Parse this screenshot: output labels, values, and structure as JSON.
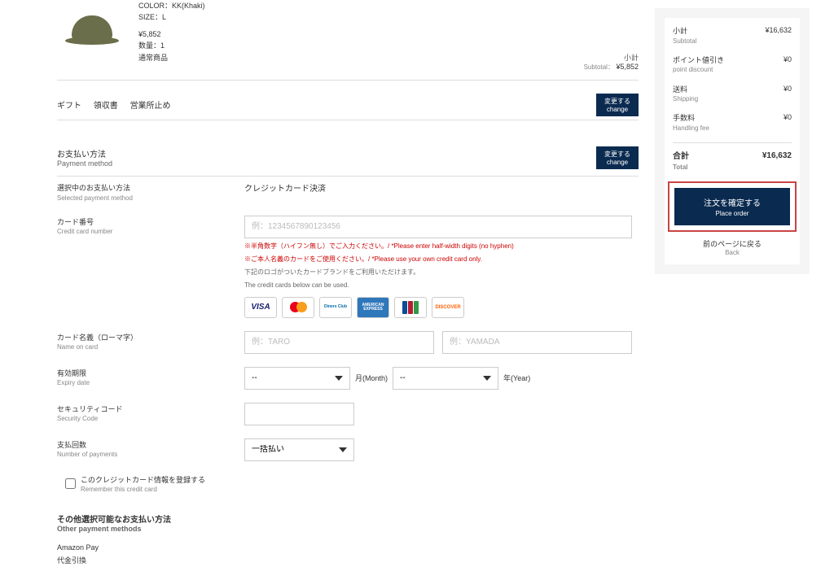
{
  "product": {
    "color_label": "COLOR：KK(Khaki)",
    "size_label": "SIZE：L",
    "price": "¥5,852",
    "qty": "数量：1",
    "type": "通常商品",
    "subtotal_jp": "小計",
    "subtotal_en": "Subtotal：",
    "subtotal_val": "¥5,852"
  },
  "gift": {
    "item1": "ギフト",
    "item2": "領収書",
    "item3": "営業所止め",
    "change_jp": "変更する",
    "change_en": "change"
  },
  "payment_section": {
    "title_jp": "お支払い方法",
    "title_en": "Payment method",
    "change_jp": "変更する",
    "change_en": "change"
  },
  "selected": {
    "label_jp": "選択中のお支払い方法",
    "label_en": "Selected payment method",
    "value": "クレジットカード決済"
  },
  "card_number": {
    "label_jp": "カード番号",
    "label_en": "Credit card number",
    "placeholder": "例：1234567890123456",
    "note1": "※半角数字（ハイフン無し）でご入力ください。/ *Please enter half-width digits (no hyphen)",
    "note2": "※ご本人名義のカードをご使用ください。/ *Please use your own credit card only.",
    "note3_jp": "下記のロゴがついたカードブランドをご利用いただけます。",
    "note3_en": "The credit cards below can be used."
  },
  "card_name": {
    "label_jp": "カード名義（ローマ字）",
    "label_en": "Name on card",
    "placeholder_first": "例：TARO",
    "placeholder_last": "例：YAMADA"
  },
  "expiry": {
    "label_jp": "有効期限",
    "label_en": "Expiry date",
    "month_opt": "--",
    "month_label": "月(Month)",
    "year_opt": "--",
    "year_label": "年(Year)"
  },
  "security": {
    "label_jp": "セキュリティコード",
    "label_en": "Security Code"
  },
  "pay_count": {
    "label_jp": "支払回数",
    "label_en": "Number of payments",
    "opt": "一括払い"
  },
  "remember": {
    "label_jp": "このクレジットカード情報を登録する",
    "label_en": "Remember this credit card"
  },
  "other": {
    "title_jp": "その他選択可能なお支払い方法",
    "title_en": "Other payment methods",
    "item1": "Amazon Pay",
    "item2": "代金引換"
  },
  "summary": {
    "subtotal_jp": "小計",
    "subtotal_en": "Subtotal",
    "subtotal_val": "¥16,632",
    "point_jp": "ポイント値引き",
    "point_en": "point discount",
    "point_val": "¥0",
    "shipping_jp": "送料",
    "shipping_en": "Shipping",
    "shipping_val": "¥0",
    "fee_jp": "手数料",
    "fee_en": "Handling fee",
    "fee_val": "¥0",
    "total_jp": "合計",
    "total_en": "Total",
    "total_val": "¥16,632",
    "place_jp": "注文を確定する",
    "place_en": "Place order",
    "back_jp": "前のページに戻る",
    "back_en": "Back"
  },
  "logos": {
    "visa": "VISA",
    "diners": "Diners Club",
    "amex": "AMERICAN EXPRESS",
    "discover": "DISCOVER"
  }
}
